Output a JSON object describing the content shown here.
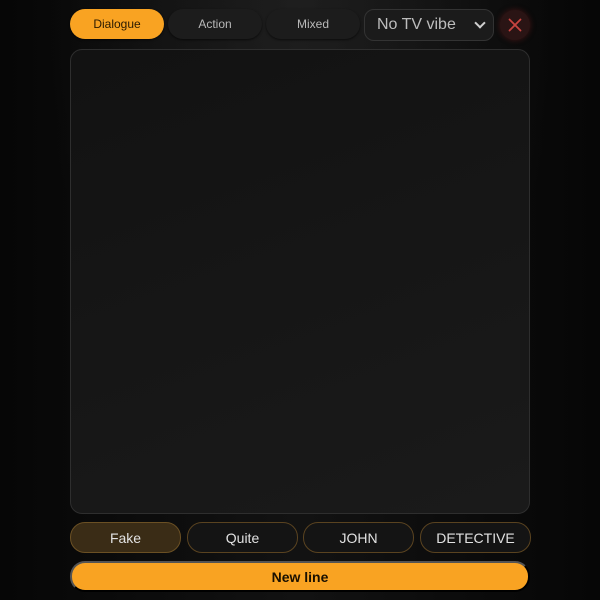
{
  "toolbar": {
    "tabs": [
      {
        "label": "Dialogue",
        "active": true
      },
      {
        "label": "Action",
        "active": false
      },
      {
        "label": "Mixed",
        "active": false
      }
    ],
    "vibe_select": {
      "selected": "No TV vibe"
    },
    "close_icon": "close-x-icon"
  },
  "editor": {
    "value": ""
  },
  "chips": [
    {
      "label": "Fake",
      "selected": true
    },
    {
      "label": "Quite",
      "selected": false
    },
    {
      "label": "JOHN",
      "selected": false
    },
    {
      "label": "DETECTIVE",
      "selected": false
    }
  ],
  "actions": {
    "new_line_label": "New line"
  },
  "colors": {
    "accent": "#f9a322",
    "background": "#0b0b0b",
    "panel": "#1a1a1a",
    "close_icon": "#c8443f",
    "chip_border": "#5a4320"
  }
}
